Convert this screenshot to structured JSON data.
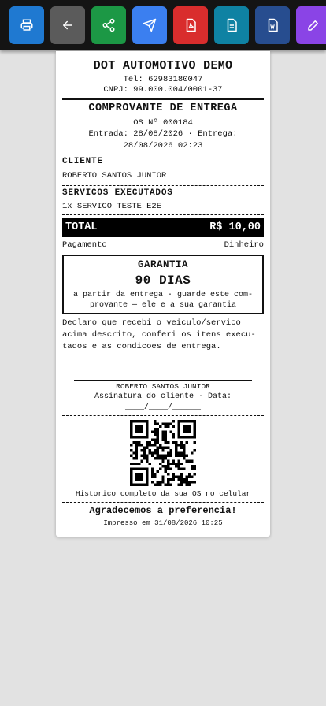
{
  "toolbar": {
    "buttons": [
      {
        "name": "print-button",
        "icon": "printer-icon",
        "color": "#1f79d1"
      },
      {
        "name": "back-button",
        "icon": "arrow-left-icon",
        "color": "#5b5b5b"
      },
      {
        "name": "share-button",
        "icon": "share-icon",
        "color": "#1c9845"
      },
      {
        "name": "send-button",
        "icon": "send-icon",
        "color": "#3b7ff0"
      },
      {
        "name": "pdf-button",
        "icon": "pdf-icon",
        "color": "#d92d2d"
      },
      {
        "name": "document-button",
        "icon": "document-icon",
        "color": "#0f82a3"
      },
      {
        "name": "word-button",
        "icon": "word-icon",
        "color": "#274d8f"
      },
      {
        "name": "edit-button",
        "icon": "edit-icon",
        "color": "#8a44e6"
      }
    ]
  },
  "receipt": {
    "shop_name": "DOT AUTOMOTIVO DEMO",
    "phone": "Tel: 62983180047",
    "cnpj": "CNPJ: 99.000.004/0001-37",
    "doc_title": "COMPROVANTE DE ENTREGA",
    "os_number": "OS Nº 000184",
    "dates_line1": "Entrada: 28/08/2026 · Entrega:",
    "dates_line2": "28/08/2026 02:23",
    "client_title": "CLIENTE",
    "client_name": "ROBERTO SANTOS JUNIOR",
    "services_title": "SERVICOS EXECUTADOS",
    "service_item": "1x SERVICO TESTE E2E",
    "total_label": "TOTAL",
    "total_value": "R$ 10,00",
    "payment_label": "Pagamento",
    "payment_value": "Dinheiro",
    "warranty_title": "GARANTIA",
    "warranty_days": "90 DIAS",
    "warranty_line1": "a partir da entrega · guarde este com-",
    "warranty_line2": "provante — ele e a sua garantia",
    "declaration_line1": "Declaro que recebi o veiculo/servico",
    "declaration_line2": "acima descrito, conferi os itens execu-",
    "declaration_line3": "tados e as condicoes de entrega.",
    "signature_name": "ROBERTO SANTOS JUNIOR",
    "signature_label": "Assinatura do cliente · Data:",
    "signature_date": "____/____/______",
    "qr_caption": "Historico completo da sua OS no celular",
    "thanks": "Agradecemos a preferencia!",
    "printed_at": "Impresso em 31/08/2026 10:25"
  }
}
